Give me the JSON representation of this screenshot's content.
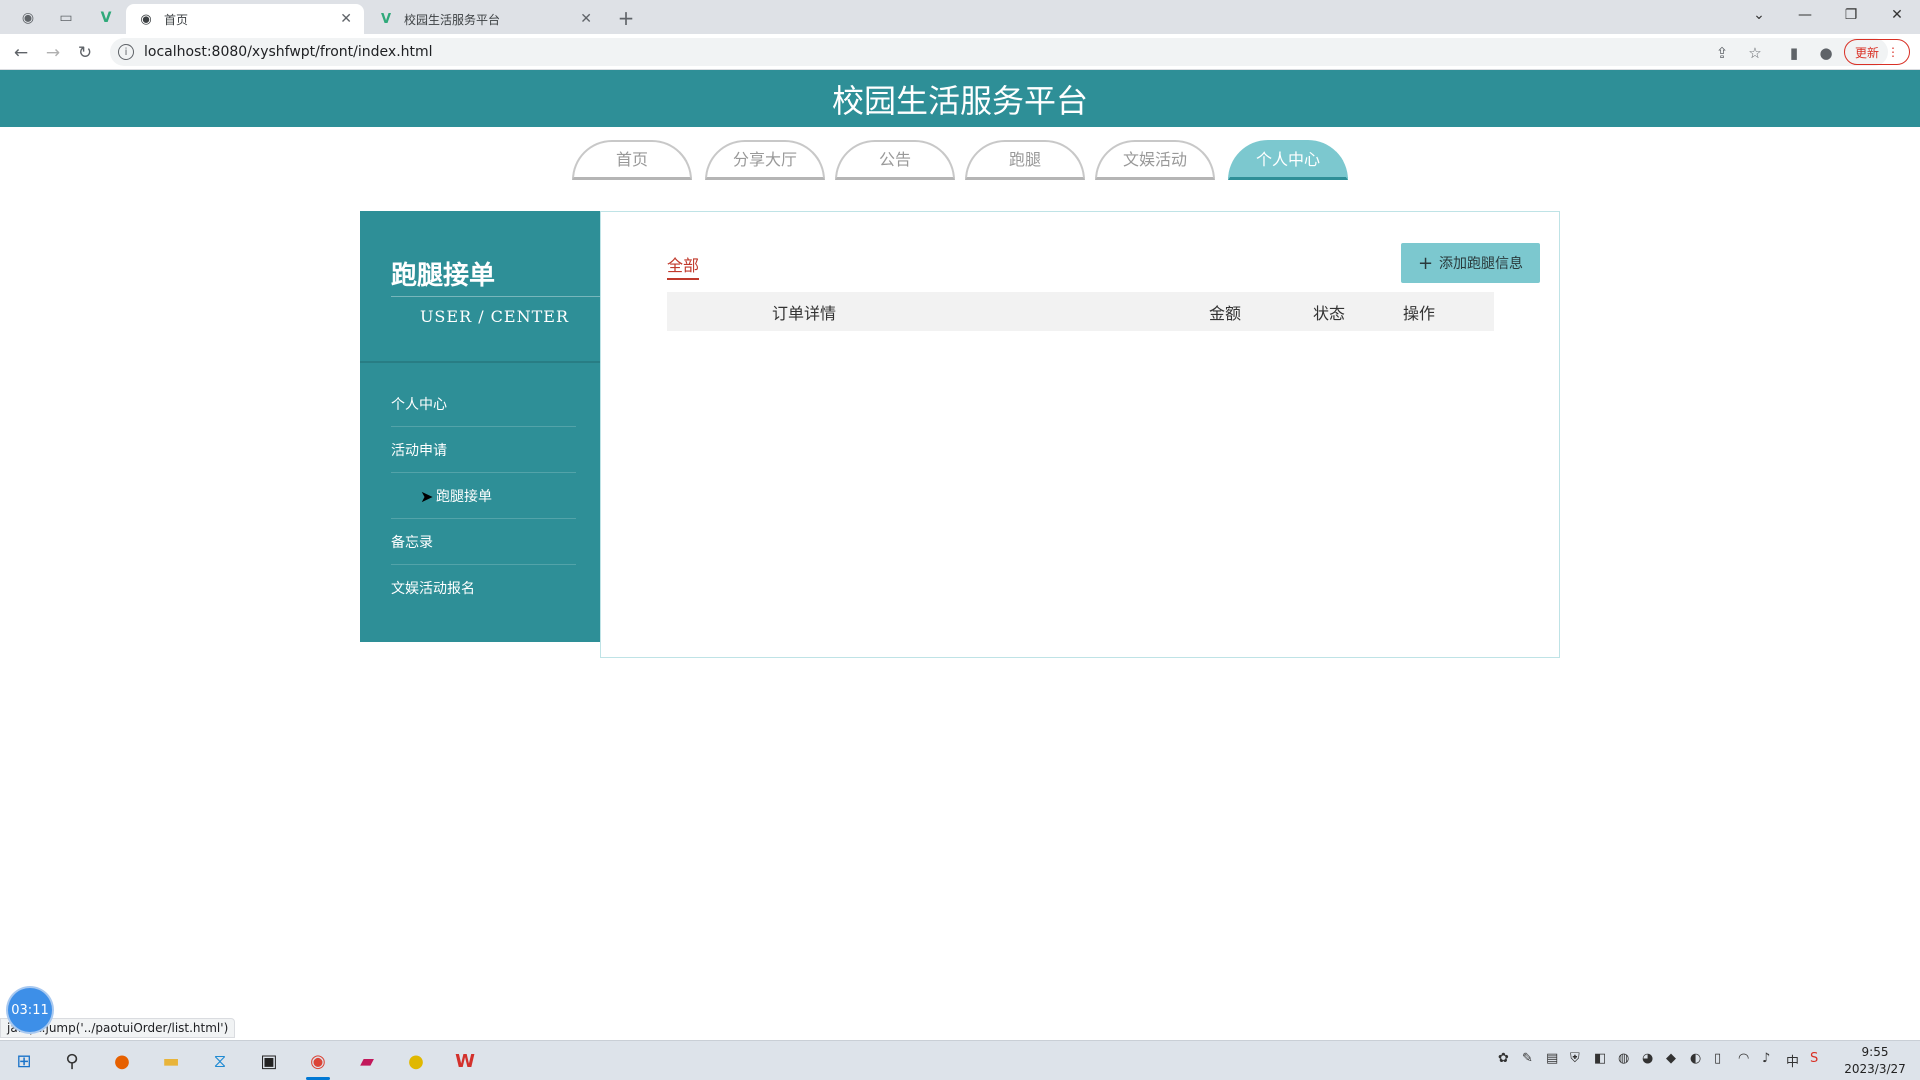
{
  "browser": {
    "tabs": [
      {
        "title": "首页",
        "active": true
      },
      {
        "title": "校园生活服务平台",
        "active": false
      }
    ],
    "url": "localhost:8080/xyshfwpt/front/index.html",
    "update_label": "更新",
    "status_url": "ja...pt:jump('../paotuiOrder/list.html')"
  },
  "site": {
    "title": "校园生活服务平台",
    "nav": [
      {
        "label": "首页"
      },
      {
        "label": "分享大厅"
      },
      {
        "label": "公告"
      },
      {
        "label": "跑腿"
      },
      {
        "label": "文娱活动"
      },
      {
        "label": "个人中心",
        "active": true
      }
    ]
  },
  "sidebar": {
    "title": "跑腿接单",
    "subtitle": "USER / CENTER",
    "items": [
      {
        "label": "个人中心"
      },
      {
        "label": "活动申请"
      },
      {
        "label": "跑腿接单",
        "active": true
      },
      {
        "label": "备忘录"
      },
      {
        "label": "文娱活动报名"
      }
    ]
  },
  "content": {
    "filter_tab": "全部",
    "add_button": "添加跑腿信息",
    "columns": [
      "订单详情",
      "金额",
      "状态",
      "操作"
    ],
    "rows": []
  },
  "overlay": {
    "timer": "03:11"
  },
  "taskbar": {
    "time": "9:55",
    "date": "2023/3/27",
    "ime": "中"
  },
  "colors": {
    "primary": "#2e8f97",
    "accent_light": "#7cc8cf",
    "filter_active": "#c0392b"
  }
}
